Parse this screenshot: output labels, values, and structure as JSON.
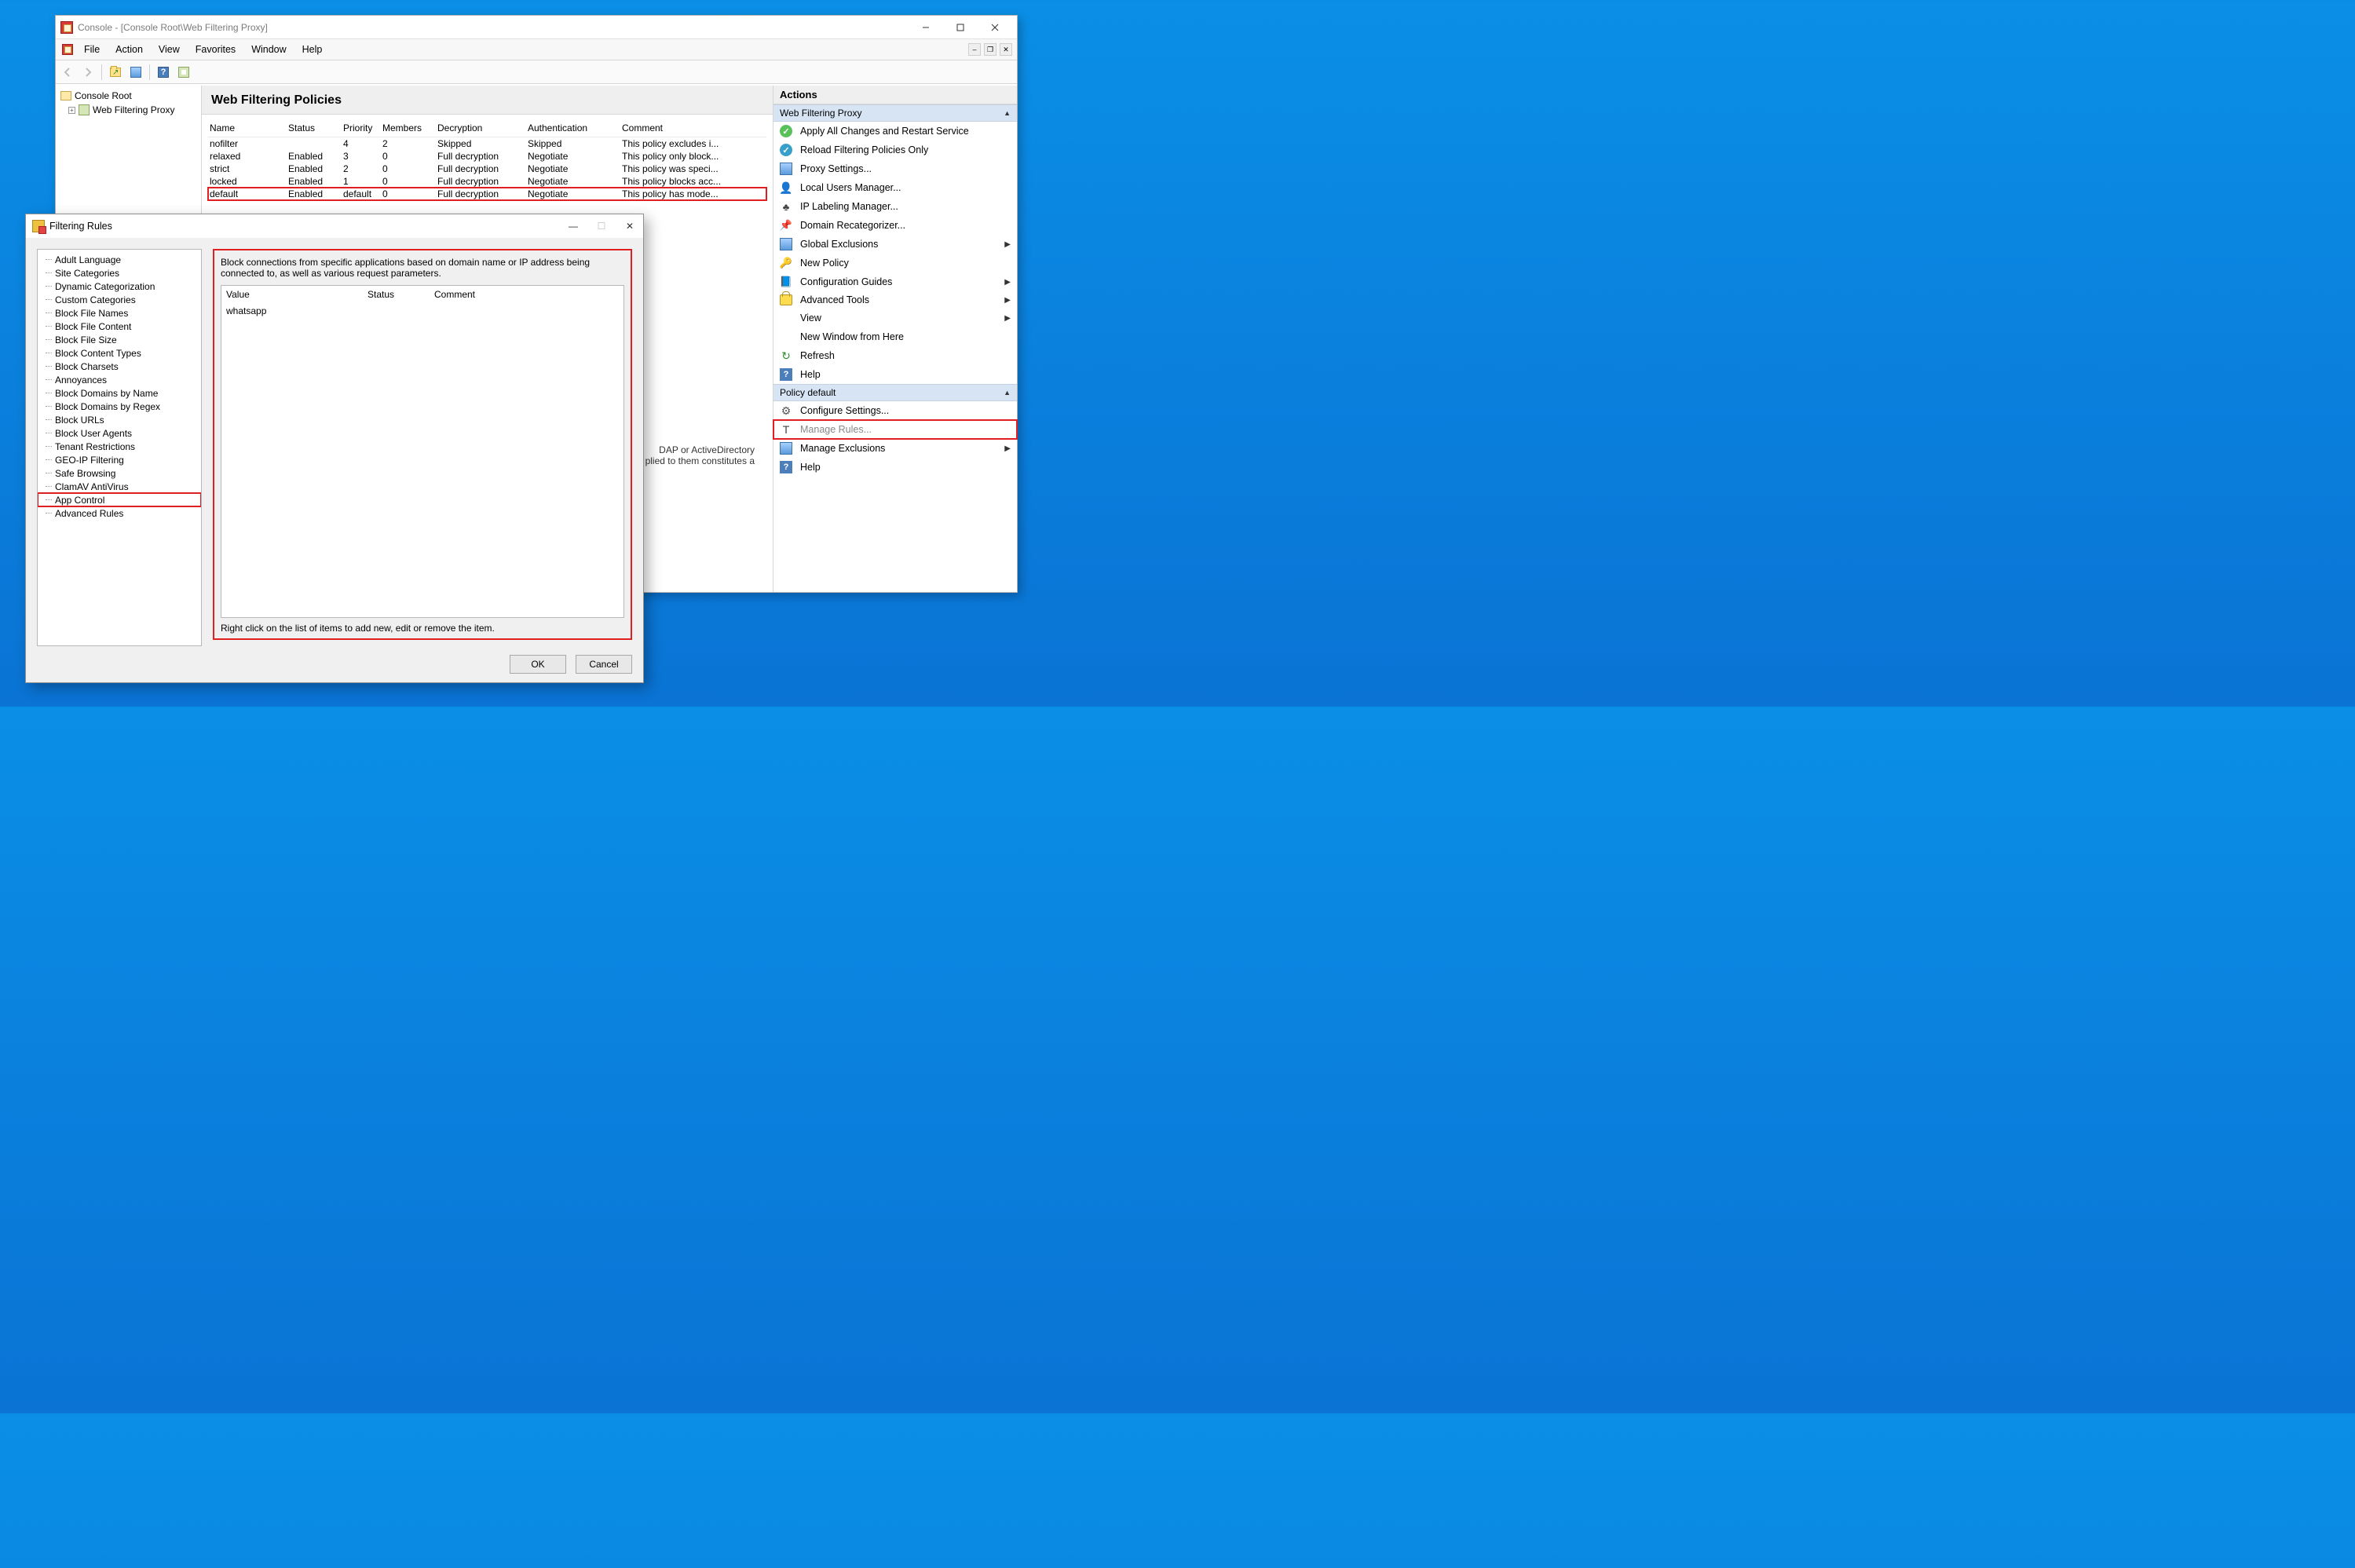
{
  "console": {
    "title": "Console - [Console Root\\Web Filtering Proxy]",
    "menus": [
      "File",
      "Action",
      "View",
      "Favorites",
      "Window",
      "Help"
    ],
    "tree": {
      "root": "Console Root",
      "child": "Web Filtering Proxy"
    },
    "center": {
      "heading": "Web Filtering Policies",
      "columns": [
        "Name",
        "Status",
        "Priority",
        "Members",
        "Decryption",
        "Authentication",
        "Comment"
      ],
      "rows": [
        {
          "name": "nofilter",
          "status": "",
          "priority": "4",
          "members": "2",
          "decryption": "Skipped",
          "auth": "Skipped",
          "comment": "This policy excludes i..."
        },
        {
          "name": "relaxed",
          "status": "Enabled",
          "priority": "3",
          "members": "0",
          "decryption": "Full decryption",
          "auth": "Negotiate",
          "comment": "This policy only block..."
        },
        {
          "name": "strict",
          "status": "Enabled",
          "priority": "2",
          "members": "0",
          "decryption": "Full decryption",
          "auth": "Negotiate",
          "comment": "This policy was speci..."
        },
        {
          "name": "locked",
          "status": "Enabled",
          "priority": "1",
          "members": "0",
          "decryption": "Full decryption",
          "auth": "Negotiate",
          "comment": "This policy blocks acc..."
        },
        {
          "name": "default",
          "status": "Enabled",
          "priority": "default",
          "members": "0",
          "decryption": "Full decryption",
          "auth": "Negotiate",
          "comment": "This policy has mode...",
          "highlight": true
        }
      ],
      "desc_tail": "DAP or ActiveDirectory\nplied to them constitutes a"
    }
  },
  "actions": {
    "title": "Actions",
    "section1": "Web Filtering Proxy",
    "section2": "Policy default",
    "items1": [
      {
        "icon": "check",
        "label": "Apply All Changes and Restart Service"
      },
      {
        "icon": "check blue",
        "label": "Reload Filtering Policies Only"
      },
      {
        "icon": "props",
        "label": "Proxy Settings..."
      },
      {
        "icon": "user",
        "glyph": "👤",
        "label": "Local Users Manager..."
      },
      {
        "icon": "tree",
        "glyph": "♣",
        "label": "IP Labeling Manager..."
      },
      {
        "icon": "pin",
        "glyph": "📌",
        "label": "Domain Recategorizer..."
      },
      {
        "icon": "grid",
        "label": "Global Exclusions",
        "sub": true
      },
      {
        "icon": "key",
        "glyph": "🔑",
        "label": "New Policy"
      },
      {
        "icon": "book",
        "glyph": "📘",
        "label": "Configuration Guides",
        "sub": true
      },
      {
        "icon": "lock",
        "label": "Advanced Tools",
        "sub": true
      },
      {
        "icon": "none",
        "label": "View",
        "sub": true
      },
      {
        "icon": "none",
        "label": "New Window from Here"
      },
      {
        "icon": "refresh",
        "glyph": "↻",
        "label": "Refresh"
      },
      {
        "icon": "help",
        "glyph": "?",
        "label": "Help"
      }
    ],
    "items2": [
      {
        "icon": "gear",
        "glyph": "⚙",
        "label": "Configure Settings..."
      },
      {
        "icon": "tool",
        "glyph": "T",
        "label": "Manage Rules...",
        "hl": true
      },
      {
        "icon": "grid",
        "label": "Manage Exclusions",
        "sub": true
      },
      {
        "icon": "help",
        "glyph": "?",
        "label": "Help"
      }
    ]
  },
  "dialog": {
    "title": "Filtering Rules",
    "tree": [
      "Adult Language",
      "Site Categories",
      "Dynamic Categorization",
      "Custom Categories",
      "Block File Names",
      "Block File Content",
      "Block File Size",
      "Block Content Types",
      "Block Charsets",
      "Annoyances",
      "Block Domains by Name",
      "Block Domains by Regex",
      "Block URLs",
      "Block User Agents",
      "Tenant Restrictions",
      "GEO-IP Filtering",
      "Safe Browsing",
      "ClamAV AntiVirus",
      {
        "label": "App Control",
        "hl": true
      },
      "Advanced Rules"
    ],
    "desc": "Block connections from specific applications based on domain name or IP address being connected to, as well as various request parameters.",
    "list_cols": [
      "Value",
      "Status",
      "Comment"
    ],
    "list_rows": [
      {
        "value": "whatsapp",
        "status": "",
        "comment": ""
      }
    ],
    "hint": "Right click on the list of items to add new, edit or remove the item.",
    "ok": "OK",
    "cancel": "Cancel"
  }
}
